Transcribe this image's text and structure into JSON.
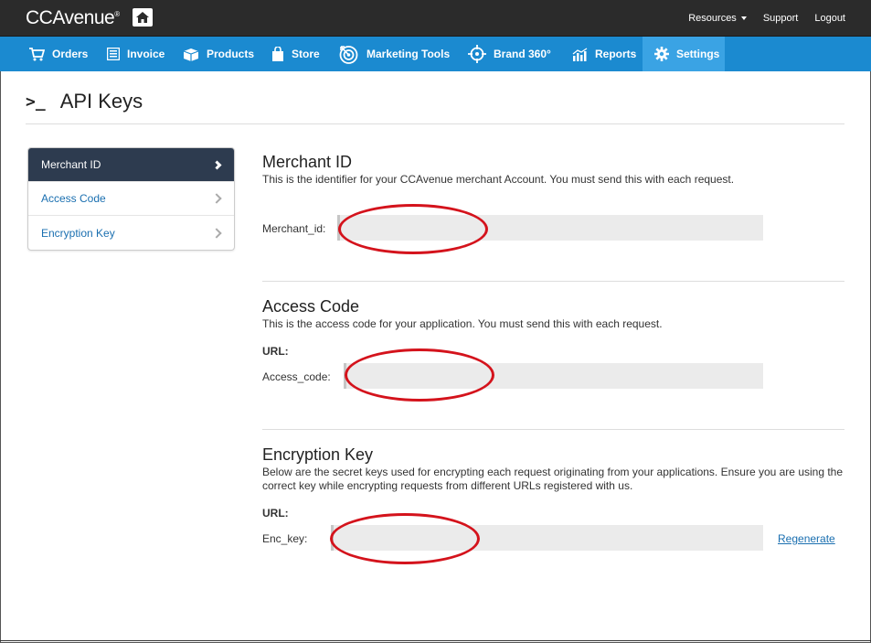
{
  "header": {
    "logo": "CCAvenue",
    "links": [
      {
        "label": "Resources"
      },
      {
        "label": "Support"
      },
      {
        "label": "Logout"
      }
    ]
  },
  "nav": [
    {
      "label": "Orders",
      "icon": "cart-icon"
    },
    {
      "label": "Invoice",
      "icon": "invoice-icon"
    },
    {
      "label": "Products",
      "icon": "box-icon"
    },
    {
      "label": "Store",
      "icon": "bag-icon"
    },
    {
      "label": "Marketing Tools",
      "icon": "target-icon"
    },
    {
      "label": "Brand 360°",
      "icon": "crosshair-icon"
    },
    {
      "label": "Reports",
      "icon": "chart-icon"
    },
    {
      "label": "Settings",
      "icon": "gear-icon",
      "active": true
    }
  ],
  "page": {
    "title": "API Keys"
  },
  "sidebar": {
    "items": [
      {
        "label": "Merchant ID",
        "active": true
      },
      {
        "label": "Access Code"
      },
      {
        "label": "Encryption Key"
      }
    ]
  },
  "sections": {
    "merchant": {
      "title": "Merchant ID",
      "description": "This is the identifier for your CCAvenue merchant Account. You must send this with each request.",
      "field_label": "Merchant_id:"
    },
    "access": {
      "title": "Access Code",
      "description": "This is the access code for your application. You must send this with each request.",
      "url_label": "URL:",
      "field_label": "Access_code:"
    },
    "encryption": {
      "title": "Encryption Key",
      "description": "Below are the secret keys used for encrypting each request originating from your applications. Ensure you are using the correct key while encrypting requests from different URLs registered with us.",
      "url_label": "URL:",
      "field_label": "Enc_key:",
      "regenerate": "Regenerate"
    }
  },
  "colors": {
    "topbar": "#2b2b2b",
    "navbar": "#1b8ad0",
    "nav_active": "#3aa3e4",
    "sidebar_active": "#2d3b4f",
    "link": "#1a6fb0",
    "redaction": "#d4131c"
  }
}
